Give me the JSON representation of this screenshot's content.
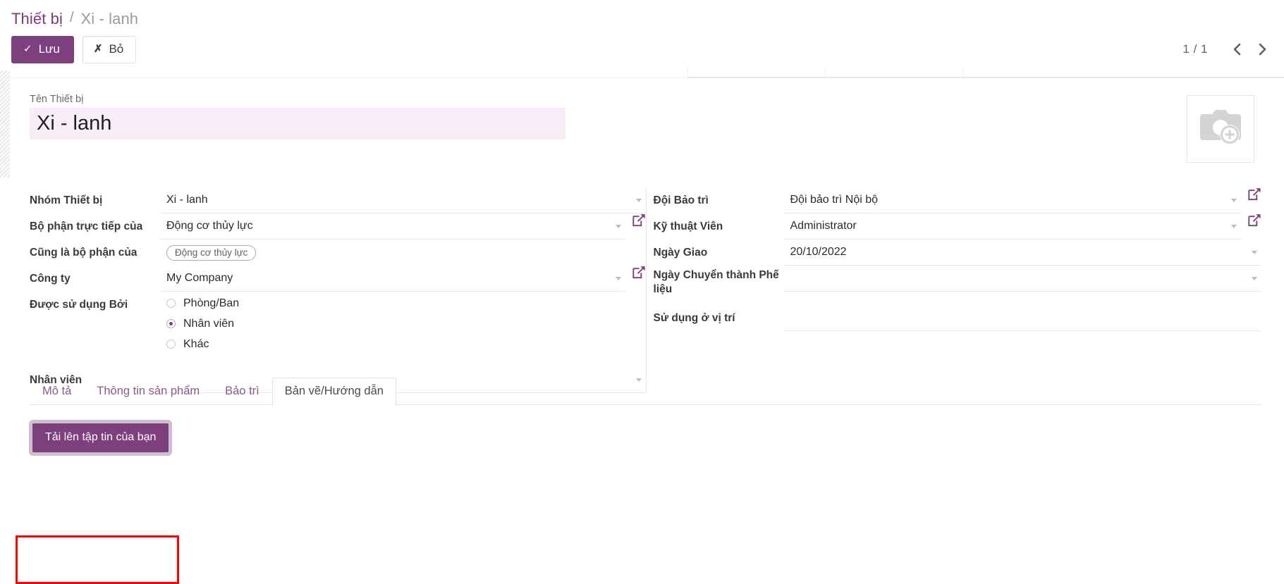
{
  "breadcrumb": {
    "root": "Thiết bị",
    "separator": "/",
    "current": "Xi - lanh"
  },
  "actions": {
    "save_label": "Lưu",
    "save_icon": "check-icon",
    "discard_label": "Bỏ",
    "discard_icon": "close-icon"
  },
  "pager": {
    "count": "1 / 1",
    "prev_icon": "chevron-left-icon",
    "next_icon": "chevron-right-icon"
  },
  "photo": {
    "icon": "camera-add-icon"
  },
  "title": {
    "label": "Tên Thiết bị",
    "value": "Xi - lanh"
  },
  "left_fields": [
    {
      "label": "Nhóm Thiết bị",
      "value": "Xi - lanh",
      "caret": true,
      "external_link": false,
      "type": "select"
    },
    {
      "label": "Bộ phận trực tiếp của",
      "value": "Động cơ thủy lực",
      "caret": true,
      "external_link": true,
      "type": "select"
    },
    {
      "label": "Cũng là bộ phận của",
      "value": "Động cơ thủy lực",
      "caret": false,
      "external_link": false,
      "type": "tag"
    },
    {
      "label": "Công ty",
      "value": "My Company",
      "caret": true,
      "external_link": true,
      "type": "select"
    }
  ],
  "used_by": {
    "label": "Được sử dụng Bởi",
    "options": [
      {
        "label": "Phòng/Ban",
        "checked": false
      },
      {
        "label": "Nhân viên",
        "checked": true
      },
      {
        "label": "Khác",
        "checked": false
      }
    ]
  },
  "employee": {
    "label": "Nhân viên",
    "value": "",
    "caret": true
  },
  "right_fields": [
    {
      "label": "Đội Bảo trì",
      "value": "Đội bảo trì Nội bộ",
      "caret": true,
      "external_link": true,
      "type": "select"
    },
    {
      "label": "Kỹ thuật Viên",
      "value": "Administrator",
      "caret": true,
      "external_link": true,
      "type": "select"
    },
    {
      "label": "Ngày Giao",
      "value": "20/10/2022",
      "caret": true,
      "external_link": false,
      "type": "date"
    },
    {
      "label": "Ngày Chuyển thành Phế liệu",
      "value": "",
      "caret": true,
      "external_link": false,
      "type": "date"
    },
    {
      "label": "Sử dụng ở vị trí",
      "value": "",
      "caret": false,
      "external_link": false,
      "type": "text"
    }
  ],
  "tabs": [
    {
      "label": "Mô tả",
      "active": false
    },
    {
      "label": "Thông tin sản phẩm",
      "active": false
    },
    {
      "label": "Bảo trì",
      "active": false
    },
    {
      "label": "Bản vẽ/Hướng dẫn",
      "active": true
    }
  ],
  "tab_body": {
    "upload_label": "Tải lên tập tin của bạn"
  },
  "colors": {
    "primary": "#7d3f7d",
    "title_bg": "#f6edf6",
    "tab_link": "#8a5a8a",
    "annotation": "#ff0000",
    "focus_ring": "#cfbdd0"
  }
}
